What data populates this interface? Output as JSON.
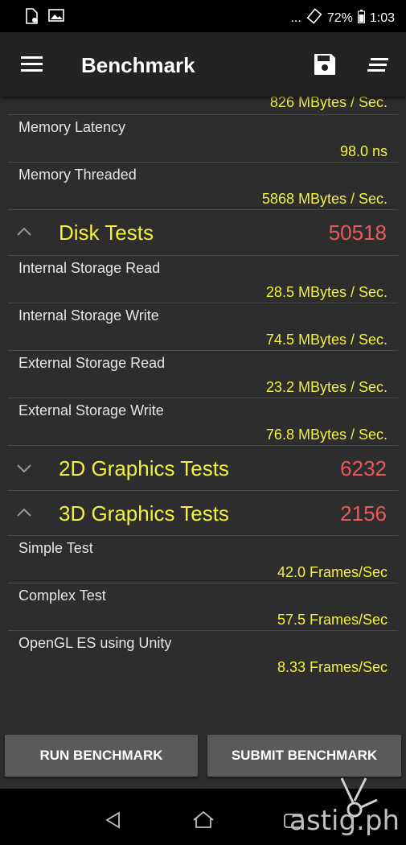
{
  "status": {
    "battery": "72%",
    "time": "1:03",
    "dots": "..."
  },
  "appbar": {
    "title": "Benchmark"
  },
  "partial_value": "826 MBytes / Sec.",
  "memory": [
    {
      "label": "Memory Latency",
      "value": "98.0 ns"
    },
    {
      "label": "Memory Threaded",
      "value": "5868 MBytes / Sec."
    }
  ],
  "disk": {
    "title": "Disk Tests",
    "score": "50518",
    "items": [
      {
        "label": "Internal Storage Read",
        "value": "28.5 MBytes / Sec."
      },
      {
        "label": "Internal Storage Write",
        "value": "74.5 MBytes / Sec."
      },
      {
        "label": "External Storage Read",
        "value": "23.2 MBytes / Sec."
      },
      {
        "label": "External Storage Write",
        "value": "76.8 MBytes / Sec."
      }
    ]
  },
  "graphics2d": {
    "title": "2D Graphics Tests",
    "score": "6232"
  },
  "graphics3d": {
    "title": "3D Graphics Tests",
    "score": "2156",
    "items": [
      {
        "label": "Simple Test",
        "value": "42.0 Frames/Sec"
      },
      {
        "label": "Complex Test",
        "value": "57.5 Frames/Sec"
      },
      {
        "label": "OpenGL ES using Unity",
        "value": "8.33 Frames/Sec"
      }
    ]
  },
  "buttons": {
    "run": "RUN BENCHMARK",
    "submit": "SUBMIT BENCHMARK"
  },
  "watermark": "astig.ph",
  "colors": {
    "value": "#f4f03c",
    "score": "#e95a5a",
    "background": "#2d2d2d"
  }
}
